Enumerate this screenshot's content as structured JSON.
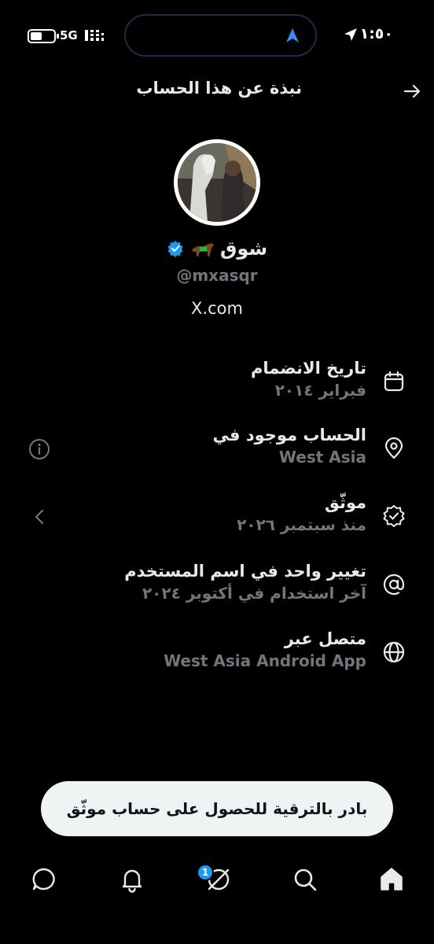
{
  "status_bar": {
    "time": "١:٥٠",
    "network": "5G"
  },
  "header": {
    "title": "نبذة عن هذا الحساب"
  },
  "profile": {
    "display_name": "شوق",
    "handle": "@mxasqr",
    "link": "X.com"
  },
  "info": [
    {
      "label": "تاريخ الانضمام",
      "value": "فبراير ٢٠١٤",
      "icon": "calendar-icon"
    },
    {
      "label": "الحساب موجود في",
      "value": "West Asia",
      "icon": "location-pin-icon"
    },
    {
      "label": "موثّق",
      "value": "منذ سبتمبر ٢٠٢٦",
      "icon": "verified-badge-icon"
    },
    {
      "label": "تغيير واحد في اسم المستخدم",
      "value": "آخر استخدام في أكتوبر ٢٠٢٤",
      "icon": "at-sign-icon"
    },
    {
      "label": "متصل عبر",
      "value": "West Asia Android App",
      "icon": "globe-icon"
    }
  ],
  "cta": {
    "label": "بادر بالترقية للحصول على حساب موثّق"
  },
  "bottom_nav": {
    "badge_count": "1",
    "items": [
      "home-icon",
      "search-icon",
      "grok-icon",
      "notifications-icon",
      "messages-icon"
    ]
  },
  "colors": {
    "background": "#000000",
    "primary_text": "#e7e9ea",
    "secondary_text": "#71767b",
    "accent": "#1d9bf0",
    "cta_bg": "#eff3f4"
  }
}
